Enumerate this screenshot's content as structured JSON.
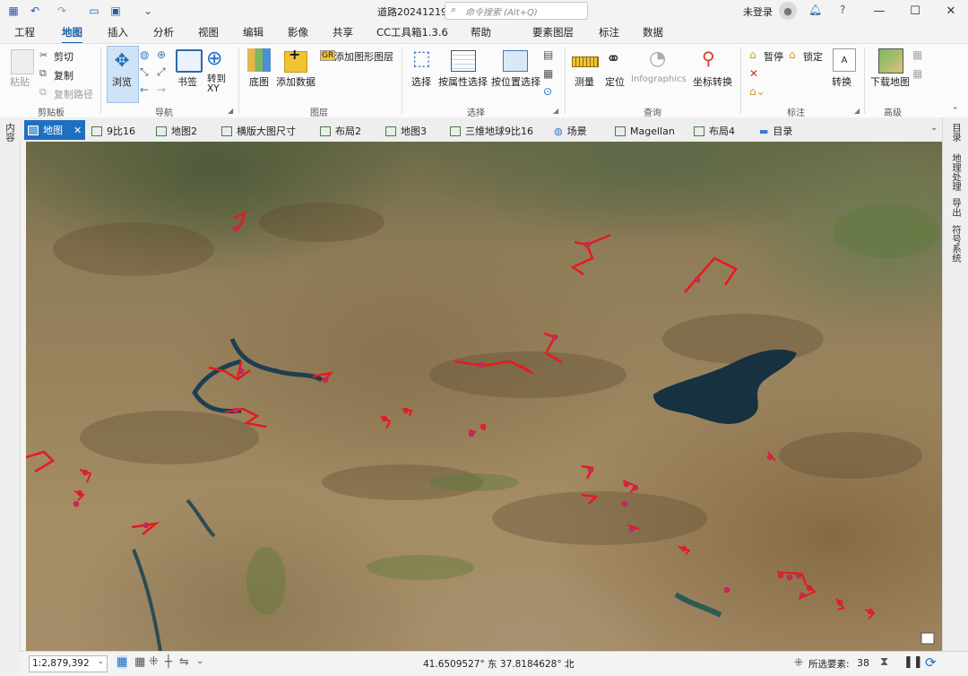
{
  "window": {
    "title": "道路20241219",
    "search_placeholder": "命令搜索 (Alt+Q)",
    "user": "未登录"
  },
  "menu": {
    "tabs": [
      "工程",
      "地图",
      "插入",
      "分析",
      "视图",
      "编辑",
      "影像",
      "共享",
      "CC工具箱1.3.6",
      "帮助"
    ],
    "active": "地图",
    "context_tabs": [
      "要素图层",
      "标注",
      "数据"
    ]
  },
  "ribbon": {
    "clipboard": {
      "paste": "粘贴",
      "cut": "剪切",
      "copy": "复制",
      "copy_path": "复制路径",
      "group": "剪贴板"
    },
    "navigate": {
      "explore": "浏览",
      "bookmark": "书签",
      "goto_xy": "转到\nXY",
      "group": "导航"
    },
    "layer": {
      "basemap": "底图",
      "add_data": "添加数据",
      "add_graphics": "添加图形图层",
      "group": "图层"
    },
    "selection": {
      "select": "选择",
      "by_attr": "按属性选择",
      "by_loc": "按位置选择",
      "group": "选择"
    },
    "inquiry": {
      "measure": "测量",
      "locate": "定位",
      "infographics": "Infographics",
      "coord_convert": "坐标转换",
      "group": "查询"
    },
    "labeling": {
      "pause": "暂停",
      "lock": "锁定",
      "convert": "转换",
      "group": "标注"
    },
    "offline": {
      "download": "下载地图",
      "group": "高级"
    }
  },
  "doc_tabs": [
    "地图",
    "9比16",
    "地图2",
    "横版大图尺寸",
    "布局2",
    "地图3",
    "三维地球9比16",
    "场景",
    "Magellan",
    "布局4",
    "目录"
  ],
  "left_pane": {
    "label": "内容"
  },
  "right_pane": {
    "labels": [
      "目录",
      "地理处理",
      "导出",
      "符号系统"
    ]
  },
  "status": {
    "scale": "1:2,879,392",
    "coordinates": "41.6509527° 东  37.8184628° 北",
    "selected_label": "所选要素:",
    "selected_count": "38"
  },
  "colors": {
    "accent": "#1f6fc0",
    "road": "#e8191f"
  }
}
